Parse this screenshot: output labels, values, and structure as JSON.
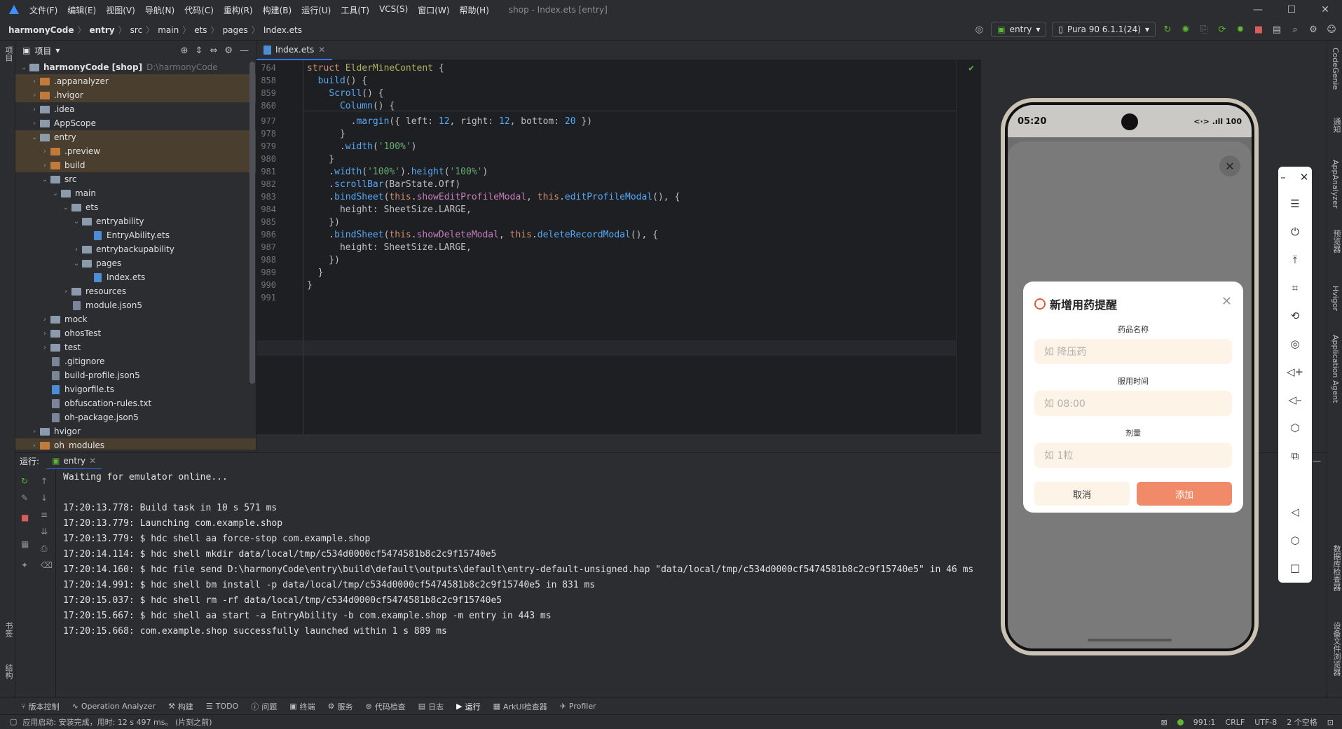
{
  "window": {
    "title": "shop - Index.ets [entry]",
    "menu": [
      "文件(F)",
      "编辑(E)",
      "视图(V)",
      "导航(N)",
      "代码(C)",
      "重构(R)",
      "构建(B)",
      "运行(U)",
      "工具(T)",
      "VCS(S)",
      "窗口(W)",
      "帮助(H)"
    ]
  },
  "breadcrumb": [
    "harmonyCode",
    "entry",
    "src",
    "main",
    "ets",
    "pages",
    "Index.ets"
  ],
  "toolbar": {
    "module_combo": "entry",
    "device_combo": "Pura 90 6.1.1(24)"
  },
  "project_panel": {
    "title": "项目",
    "tree": [
      {
        "label": "harmonyCode [shop]",
        "suffix": "D:\\harmonyCode",
        "depth": 0,
        "type": "folder",
        "expanded": true
      },
      {
        "label": ".appanalyzer",
        "depth": 1,
        "type": "folder-orange",
        "expanded": false,
        "hl": true
      },
      {
        "label": ".hvigor",
        "depth": 1,
        "type": "folder-orange",
        "expanded": false,
        "hl": true
      },
      {
        "label": ".idea",
        "depth": 1,
        "type": "folder",
        "expanded": false
      },
      {
        "label": "AppScope",
        "depth": 1,
        "type": "folder",
        "expanded": false
      },
      {
        "label": "entry",
        "depth": 1,
        "type": "folder",
        "expanded": true,
        "hl": true
      },
      {
        "label": ".preview",
        "depth": 2,
        "type": "folder-orange",
        "expanded": false,
        "hl": true
      },
      {
        "label": "build",
        "depth": 2,
        "type": "folder-orange",
        "expanded": false,
        "hl": true
      },
      {
        "label": "src",
        "depth": 2,
        "type": "folder",
        "expanded": true
      },
      {
        "label": "main",
        "depth": 3,
        "type": "folder",
        "expanded": true
      },
      {
        "label": "ets",
        "depth": 4,
        "type": "folder",
        "expanded": true
      },
      {
        "label": "entryability",
        "depth": 5,
        "type": "folder",
        "expanded": true
      },
      {
        "label": "EntryAbility.ets",
        "depth": 6,
        "type": "file-blue"
      },
      {
        "label": "entrybackupability",
        "depth": 5,
        "type": "folder",
        "expanded": false
      },
      {
        "label": "pages",
        "depth": 5,
        "type": "folder",
        "expanded": true
      },
      {
        "label": "Index.ets",
        "depth": 6,
        "type": "file-blue"
      },
      {
        "label": "resources",
        "depth": 4,
        "type": "folder",
        "expanded": false
      },
      {
        "label": "module.json5",
        "depth": 4,
        "type": "file"
      },
      {
        "label": "mock",
        "depth": 2,
        "type": "folder",
        "expanded": false
      },
      {
        "label": "ohosTest",
        "depth": 2,
        "type": "folder",
        "expanded": false
      },
      {
        "label": "test",
        "depth": 2,
        "type": "folder",
        "expanded": false
      },
      {
        "label": ".gitignore",
        "depth": 2,
        "type": "file"
      },
      {
        "label": "build-profile.json5",
        "depth": 2,
        "type": "file"
      },
      {
        "label": "hvigorfile.ts",
        "depth": 2,
        "type": "file-blue"
      },
      {
        "label": "obfuscation-rules.txt",
        "depth": 2,
        "type": "file"
      },
      {
        "label": "oh-package.json5",
        "depth": 2,
        "type": "file"
      },
      {
        "label": "hvigor",
        "depth": 1,
        "type": "folder",
        "expanded": false
      },
      {
        "label": "oh_modules",
        "depth": 1,
        "type": "folder-orange",
        "expanded": false,
        "hl": true
      }
    ]
  },
  "editor": {
    "tab": "Index.ets",
    "lines": [
      {
        "n": "764",
        "html": "<span class=\"kw\">struct</span> <span class=\"cls\">ElderMineContent</span> {"
      },
      {
        "n": "858",
        "html": "  <span class=\"fn\">build</span>() {"
      },
      {
        "n": "859",
        "html": "    <span class=\"fn\">Scroll</span>() {"
      },
      {
        "n": "860",
        "html": "      <span class=\"fn\">Column</span>() {"
      },
      {
        "n": "977",
        "html": "        .<span class=\"fn\">margin</span>({ left: <span class=\"fn\">12</span>, right: <span class=\"fn\">12</span>, bottom: <span class=\"fn\">20</span> })"
      },
      {
        "n": "978",
        "html": "      }"
      },
      {
        "n": "979",
        "html": "      .<span class=\"fn\">width</span>(<span class=\"str\">'100%'</span>)"
      },
      {
        "n": "980",
        "html": "    }"
      },
      {
        "n": "981",
        "html": "    .<span class=\"fn\">width</span>(<span class=\"str\">'100%'</span>).<span class=\"fn\">height</span>(<span class=\"str\">'100%'</span>)"
      },
      {
        "n": "982",
        "html": "    .<span class=\"fn\">scrollBar</span>(BarState.Off)"
      },
      {
        "n": "983",
        "html": "    .<span class=\"fn\">bindSheet</span>(<span class=\"this\">this</span>.<span class=\"prop\">showEditProfileModal</span>, <span class=\"this\">this</span>.<span class=\"fn\">editProfileModal</span>(), {"
      },
      {
        "n": "984",
        "html": "      height: SheetSize.LARGE,"
      },
      {
        "n": "985",
        "html": "    })"
      },
      {
        "n": "986",
        "html": "    .<span class=\"fn\">bindSheet</span>(<span class=\"this\">this</span>.<span class=\"prop\">showDeleteModal</span>, <span class=\"this\">this</span>.<span class=\"fn\">deleteRecordModal</span>(), {"
      },
      {
        "n": "987",
        "html": "      height: SheetSize.LARGE,"
      },
      {
        "n": "988",
        "html": "    })"
      },
      {
        "n": "989",
        "html": "  }"
      },
      {
        "n": "990",
        "html": "}"
      },
      {
        "n": "991",
        "html": ""
      }
    ]
  },
  "run": {
    "label": "运行:",
    "tab": "entry",
    "console": [
      "Waiting for emulator online...",
      "",
      "17:20:13.778: Build task in 10 s 571 ms",
      "17:20:13.779: Launching com.example.shop",
      "17:20:13.779: $ hdc shell aa force-stop com.example.shop",
      "17:20:14.114: $ hdc shell mkdir data/local/tmp/c534d0000cf5474581b8c2c9f15740e5",
      "17:20:14.160: $ hdc file send D:\\harmonyCode\\entry\\build\\default\\outputs\\default\\entry-default-unsigned.hap \"data/local/tmp/c534d0000cf5474581b8c2c9f15740e5\" in 46 ms",
      "17:20:14.991: $ hdc shell bm install -p data/local/tmp/c534d0000cf5474581b8c2c9f15740e5 in 831 ms",
      "17:20:15.037: $ hdc shell rm -rf data/local/tmp/c534d0000cf5474581b8c2c9f15740e5",
      "17:20:15.667: $ hdc shell aa start -a EntryAbility -b com.example.shop -m entry in 443 ms",
      "17:20:15.668: com.example.shop successfully launched within 1 s 889 ms"
    ]
  },
  "bottom_tools": [
    "版本控制",
    "Operation Analyzer",
    "构建",
    "TODO",
    "问题",
    "终端",
    "服务",
    "代码检查",
    "日志",
    "运行",
    "ArkUI检查器",
    "Profiler"
  ],
  "status": {
    "message": "应用启动: 安装完成，用时: 12 s 497 ms。 (片刻之前)",
    "position": "991:1",
    "line_sep": "CRLF",
    "encoding": "UTF-8",
    "indent": "2 个空格"
  },
  "left_stripe": {
    "top": "项目",
    "bottom1": "书签",
    "bottom2": "结构"
  },
  "right_stripe": [
    "CodeGenie",
    "通知",
    "AppAnalyzer",
    "预览器",
    "Hvigor",
    "Application Agent",
    "数据库检查器",
    "设备文件浏览器"
  ],
  "phone": {
    "time": "05:20",
    "status_icons": "<·> .ıll 100",
    "dialog": {
      "title": "新增用药提醒",
      "fields": [
        {
          "label": "药品名称",
          "placeholder": "如 降压药"
        },
        {
          "label": "服用时间",
          "placeholder": "如 08:00"
        },
        {
          "label": "剂量",
          "placeholder": "如 1粒"
        }
      ],
      "cancel": "取消",
      "add": "添加"
    }
  }
}
